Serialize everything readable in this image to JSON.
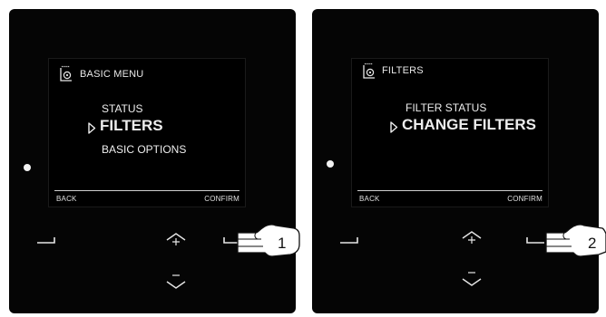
{
  "panels": [
    {
      "screen": {
        "title": "BASIC MENU",
        "icon": "menu-book-icon",
        "items": [
          "STATUS",
          "FILTERS",
          "BASIC OPTIONS"
        ],
        "selected_index": 1,
        "softkeys": {
          "left": "BACK",
          "right": "CONFIRM"
        }
      },
      "step_number": "1"
    },
    {
      "screen": {
        "title": "FILTERS",
        "icon": "menu-book-icon",
        "items": [
          "FILTER STATUS",
          "CHANGE FILTERS"
        ],
        "selected_index": 1,
        "softkeys": {
          "left": "BACK",
          "right": "CONFIRM"
        }
      },
      "step_number": "2"
    }
  ],
  "colors": {
    "panel": "#050505",
    "screen": "#000000",
    "text": "#ededed",
    "led": "#f2f2f2"
  }
}
